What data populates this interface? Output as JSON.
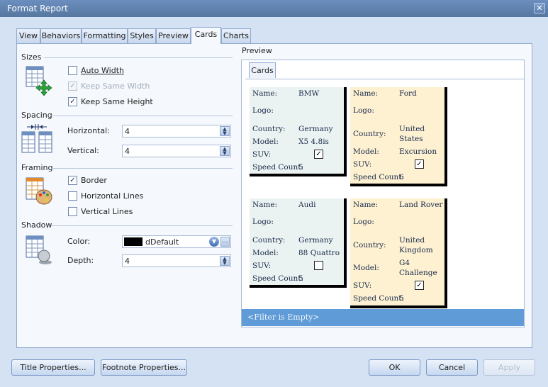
{
  "window": {
    "title": "Format Report"
  },
  "tabs": [
    "View",
    "Behaviors",
    "Formatting",
    "Styles",
    "Preview",
    "Cards",
    "Charts"
  ],
  "active_tab": "Cards",
  "sizes": {
    "group_label": "Sizes",
    "auto_width": {
      "label": "Auto Width",
      "checked": false
    },
    "keep_same_width": {
      "label": "Keep Same Width",
      "checked": true,
      "disabled": true
    },
    "keep_same_height": {
      "label": "Keep Same Height",
      "checked": true
    }
  },
  "spacing": {
    "group_label": "Spacing",
    "horizontal_label": "Horizontal:",
    "horizontal_value": "4",
    "vertical_label": "Vertical:",
    "vertical_value": "4"
  },
  "framing": {
    "group_label": "Framing",
    "border": {
      "label": "Border",
      "checked": true
    },
    "horizontal_lines": {
      "label": "Horizontal Lines",
      "checked": false
    },
    "vertical_lines": {
      "label": "Vertical Lines",
      "checked": false
    }
  },
  "shadow": {
    "group_label": "Shadow",
    "color_label": "Color:",
    "color_value": "dDefault",
    "color_swatch": "#000000",
    "depth_label": "Depth:",
    "depth_value": "4"
  },
  "preview": {
    "group_label": "Preview",
    "tab_label": "Cards",
    "field_labels": {
      "name": "Name:",
      "logo": "Logo:",
      "country": "Country:",
      "model": "Model:",
      "suv": "SUV:",
      "speed_count": "Speed Count:"
    },
    "cards": [
      {
        "name": "BMW",
        "country": "Germany",
        "model": "X5 4.8is",
        "suv": true,
        "speed_count": "5",
        "color": "#ebf3f2"
      },
      {
        "name": "Ford",
        "country": "United States",
        "model": "Excursion",
        "suv": true,
        "speed_count": "6",
        "color": "#fdf1d2"
      },
      {
        "name": "Audi",
        "country": "Germany",
        "model": "88 Quattro",
        "suv": false,
        "speed_count": "5",
        "color": "#ebf3f2"
      },
      {
        "name": "Land Rover",
        "country": "United Kingdom",
        "model": "G4 Challenge",
        "suv": true,
        "speed_count": "5",
        "color": "#fdf1d2"
      }
    ],
    "filter_text": "<Filter is Empty>"
  },
  "buttons": {
    "title_properties": "Title Properties...",
    "footnote_properties": "Footnote Properties...",
    "ok": "OK",
    "cancel": "Cancel",
    "apply": "Apply"
  }
}
